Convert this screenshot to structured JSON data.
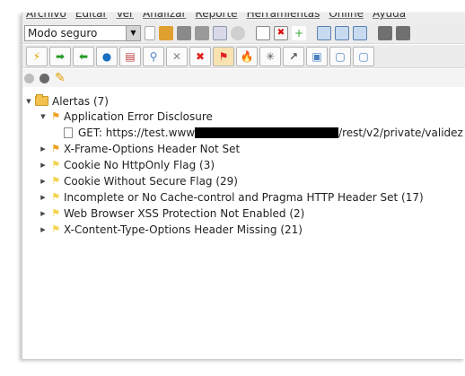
{
  "menu": [
    "Archivo",
    "Editar",
    "Ver",
    "Analizar",
    "Reporte",
    "Herramientas",
    "Online",
    "Ayuda"
  ],
  "mode": {
    "value": "Modo seguro"
  },
  "tree": {
    "root_label": "Alertas (7)",
    "alerts": [
      {
        "label": "Application Error Disclosure",
        "flag_color": "#f0a020",
        "expanded": true,
        "children": [
          {
            "prefix": "GET: https://test.www",
            "suffix": "/rest/v2/private/validez"
          }
        ]
      },
      {
        "label": "X-Frame-Options Header Not Set",
        "flag_color": "#f0a020",
        "expanded": false
      },
      {
        "label": "Cookie No HttpOnly Flag (3)",
        "flag_color": "#f3d34a",
        "expanded": false
      },
      {
        "label": "Cookie Without Secure Flag (29)",
        "flag_color": "#f3d34a",
        "expanded": false
      },
      {
        "label": "Incomplete or No Cache-control and Pragma HTTP Header Set (17)",
        "flag_color": "#f3d34a",
        "expanded": false
      },
      {
        "label": "Web Browser XSS Protection Not Enabled (2)",
        "flag_color": "#f3d34a",
        "expanded": false
      },
      {
        "label": "X-Content-Type-Options Header Missing (21)",
        "flag_color": "#f3d34a",
        "expanded": false
      }
    ]
  }
}
